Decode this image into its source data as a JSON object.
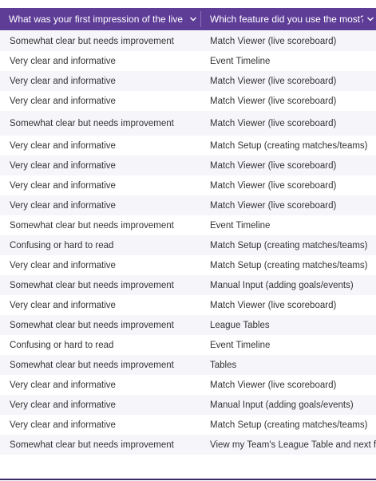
{
  "columns": [
    "What was your first impression of the live score",
    "Which feature did you use the most?"
  ],
  "rows": [
    [
      "Somewhat clear but needs improvement",
      "Match Viewer (live scoreboard)"
    ],
    [
      "Very clear and informative",
      "Event Timeline"
    ],
    [
      "Very clear and informative",
      "Match Viewer (live scoreboard)"
    ],
    [
      "Very clear and informative",
      "Match Viewer (live scoreboard)"
    ],
    [
      "Somewhat clear but needs improvement",
      "Match Viewer (live scoreboard)"
    ],
    [
      "Very clear and informative",
      "Match Setup (creating matches/teams)"
    ],
    [
      "Very clear and informative",
      "Match Viewer (live scoreboard)"
    ],
    [
      "Very clear and informative",
      "Match Viewer (live scoreboard)"
    ],
    [
      "Very clear and informative",
      "Match Viewer (live scoreboard)"
    ],
    [
      "Somewhat clear but needs improvement",
      "Event Timeline"
    ],
    [
      "Confusing or hard to read",
      "Match Setup (creating matches/teams)"
    ],
    [
      "Very clear and informative",
      "Match Setup (creating matches/teams)"
    ],
    [
      "Somewhat clear but needs improvement",
      "Manual Input (adding goals/events)"
    ],
    [
      "Very clear and informative",
      "Match Viewer (live scoreboard)"
    ],
    [
      "Somewhat clear but needs improvement",
      "League Tables"
    ],
    [
      "Confusing or hard to read",
      "Event Timeline"
    ],
    [
      "Somewhat clear but needs improvement",
      "Tables"
    ],
    [
      "Very clear and informative",
      "Match Viewer (live scoreboard)"
    ],
    [
      "Very clear and informative",
      "Manual Input (adding goals/events)"
    ],
    [
      "Very clear and informative",
      "Match Setup (creating matches/teams)"
    ],
    [
      "Somewhat clear but needs improvement",
      "View my Team's League Table and next fi"
    ]
  ],
  "colors": {
    "header_bg": "#5e3d97",
    "header_text": "#ffffff",
    "row_alt": "#f6f5f9",
    "row_text": "#333333"
  },
  "icons": [
    "chevron-down-icon"
  ]
}
